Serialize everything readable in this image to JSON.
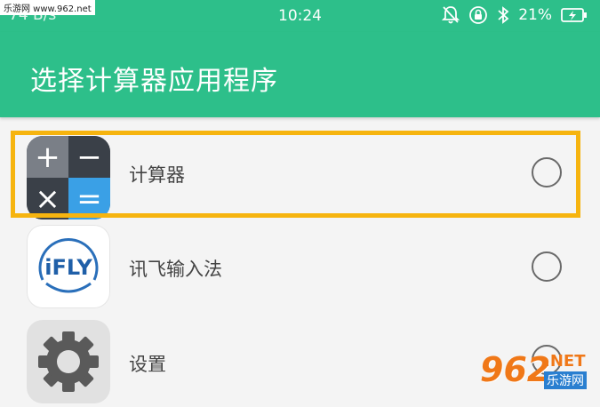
{
  "status_bar": {
    "network_speed": "74 B/s",
    "time": "10:24",
    "battery_percent": "21%"
  },
  "watermarks": {
    "top_left": "乐游网 www.962.net",
    "bottom_right_number": "962",
    "bottom_right_suffix": ".NET",
    "bottom_right_cn": "乐游网"
  },
  "app_bar": {
    "title": "选择计算器应用程序"
  },
  "apps": [
    {
      "label": "计算器",
      "icon": "calculator-icon",
      "selected": false,
      "highlighted": true
    },
    {
      "label": "讯飞输入法",
      "icon": "ifly-icon",
      "icon_text": "iFLY",
      "selected": false,
      "highlighted": false
    },
    {
      "label": "设置",
      "icon": "settings-gear-icon",
      "selected": false,
      "highlighted": false
    }
  ],
  "colors": {
    "accent": "#2dbf8a",
    "highlight_border": "#f6b40f"
  }
}
